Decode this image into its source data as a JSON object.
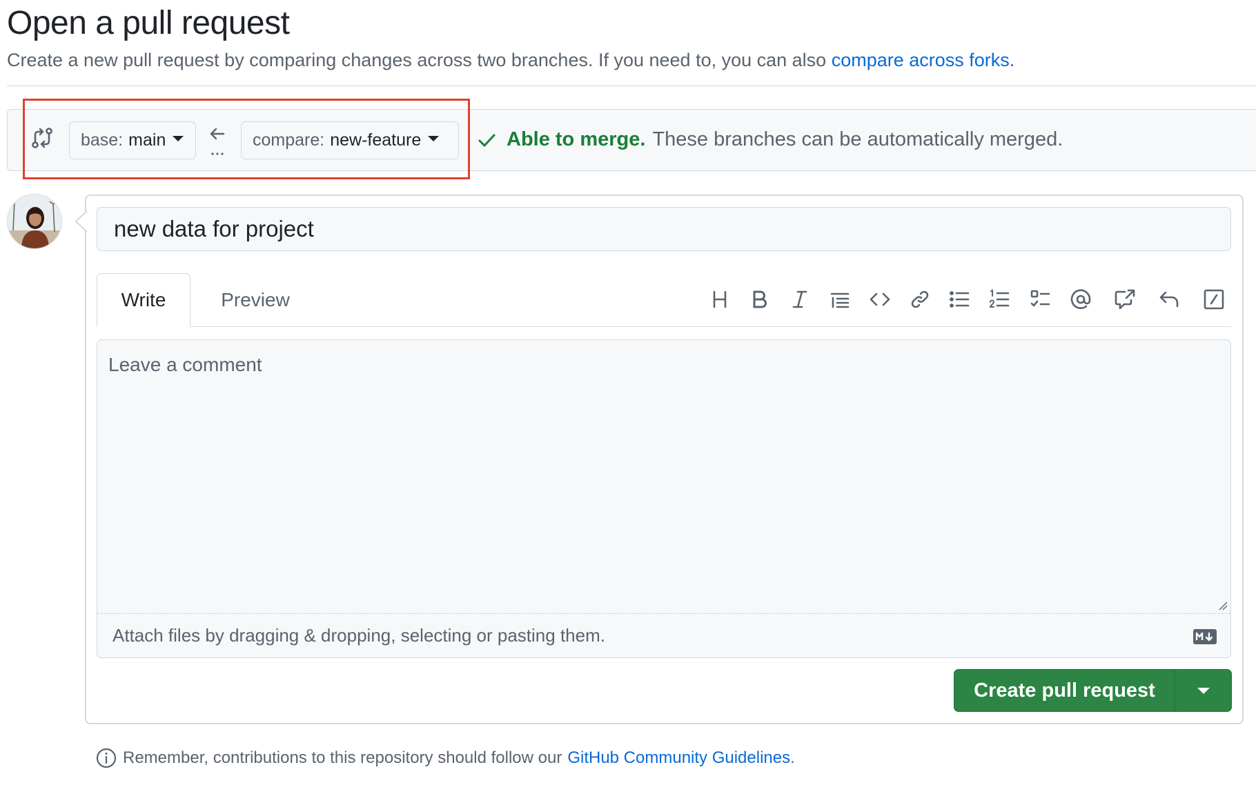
{
  "page": {
    "title": "Open a pull request",
    "subtitle": "Create a new pull request by comparing changes across two branches. If you need to, you can also",
    "subtitle_link": "compare across forks",
    "subtitle_end": "."
  },
  "range": {
    "compare_icon": "git-compare-icon",
    "base_prefix": "base:",
    "base_value": "main",
    "arrow_icon": "arrow-left-icon",
    "compare_prefix": "compare:",
    "compare_value": "new-feature",
    "merge_ok": "Able to merge.",
    "merge_msg": "These branches can be automatically merged."
  },
  "form": {
    "title_value": "new data for project",
    "tabs": [
      {
        "label": "Write"
      },
      {
        "label": "Preview"
      }
    ],
    "toolbar": [
      "heading-icon",
      "bold-icon",
      "italic-icon",
      "quote-icon",
      "code-icon",
      "link-icon",
      "unordered-list-icon",
      "ordered-list-icon",
      "task-list-icon",
      "mention-icon",
      "cross-reference-icon",
      "reply-icon",
      "slash-commands-icon"
    ],
    "comment_placeholder": "Leave a comment",
    "attach_text": "Attach files by dragging & dropping, selecting or pasting them.",
    "markdown_icon": "markdown-icon",
    "submit_label": "Create pull request"
  },
  "footer": {
    "note": "Remember, contributions to this repository should follow our",
    "link": "GitHub Community Guidelines",
    "end": "."
  },
  "colors": {
    "accent_link": "#0969da",
    "success": "#1a7f37",
    "button_green": "#2c8544",
    "highlight_red": "#e0412c"
  }
}
